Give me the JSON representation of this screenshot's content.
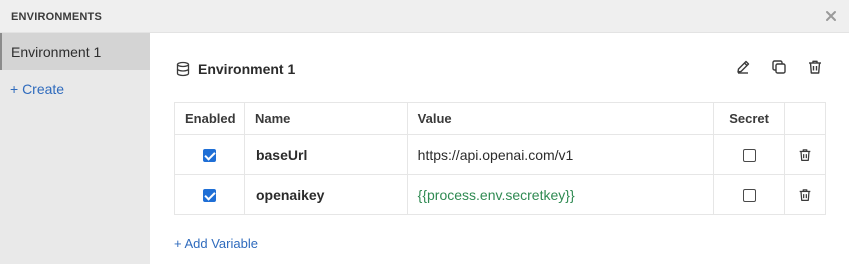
{
  "window": {
    "title": "ENVIRONMENTS"
  },
  "sidebar": {
    "items": [
      {
        "label": "Environment 1",
        "selected": true
      }
    ],
    "create_label": "+ Create"
  },
  "environment": {
    "name": "Environment 1"
  },
  "table": {
    "headers": {
      "enabled": "Enabled",
      "name": "Name",
      "value": "Value",
      "secret": "Secret"
    },
    "rows": [
      {
        "enabled": true,
        "name": "baseUrl",
        "value": "https://api.openai.com/v1",
        "secret": false
      },
      {
        "enabled": true,
        "name": "openaikey",
        "value": "{{process.env.secretkey}}",
        "secret": false
      }
    ]
  },
  "add_variable_label": "+ Add Variable",
  "icons": {
    "header": [
      "database-icon"
    ],
    "actions": [
      "edit-icon",
      "copy-icon",
      "trash-icon"
    ],
    "close": "close-icon"
  },
  "colors": {
    "accent": "#1f6fd6",
    "link": "#2f6bbd",
    "variable_value": "#2f8a52"
  }
}
